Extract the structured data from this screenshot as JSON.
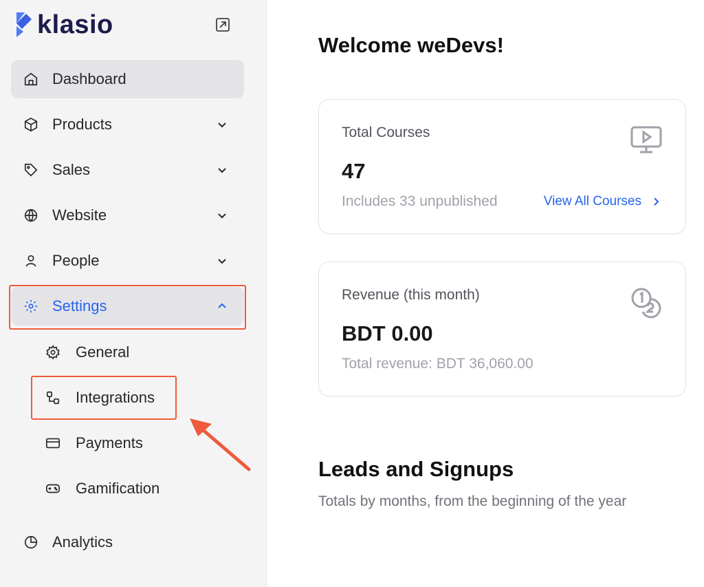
{
  "app": {
    "name": "klasio"
  },
  "sidebar": {
    "items": [
      {
        "label": "Dashboard",
        "icon": "home-icon"
      },
      {
        "label": "Products",
        "icon": "box-icon"
      },
      {
        "label": "Sales",
        "icon": "tag-icon"
      },
      {
        "label": "Website",
        "icon": "globe-icon"
      },
      {
        "label": "People",
        "icon": "user-icon"
      },
      {
        "label": "Settings",
        "icon": "gear-icon"
      }
    ],
    "settings_sub": [
      {
        "label": "General",
        "icon": "cog-icon"
      },
      {
        "label": "Integrations",
        "icon": "integrations-icon"
      },
      {
        "label": "Payments",
        "icon": "credit-card-icon"
      },
      {
        "label": "Gamification",
        "icon": "gamepad-icon"
      }
    ],
    "analytics": {
      "label": "Analytics",
      "icon": "pie-chart-icon"
    }
  },
  "main": {
    "welcome": "Welcome weDevs!",
    "courses_card": {
      "label": "Total Courses",
      "value": "47",
      "sub": "Includes 33 unpublished",
      "link": "View All Courses"
    },
    "revenue_card": {
      "label": "Revenue (this month)",
      "value": "BDT 0.00",
      "sub": "Total revenue: BDT 36,060.00"
    },
    "leads": {
      "title": "Leads and Signups",
      "subtitle": "Totals by months, from the beginning of the year"
    }
  },
  "colors": {
    "accent": "#2563eb",
    "highlight": "#ef5a3c",
    "brand": "#1e1b4b"
  }
}
